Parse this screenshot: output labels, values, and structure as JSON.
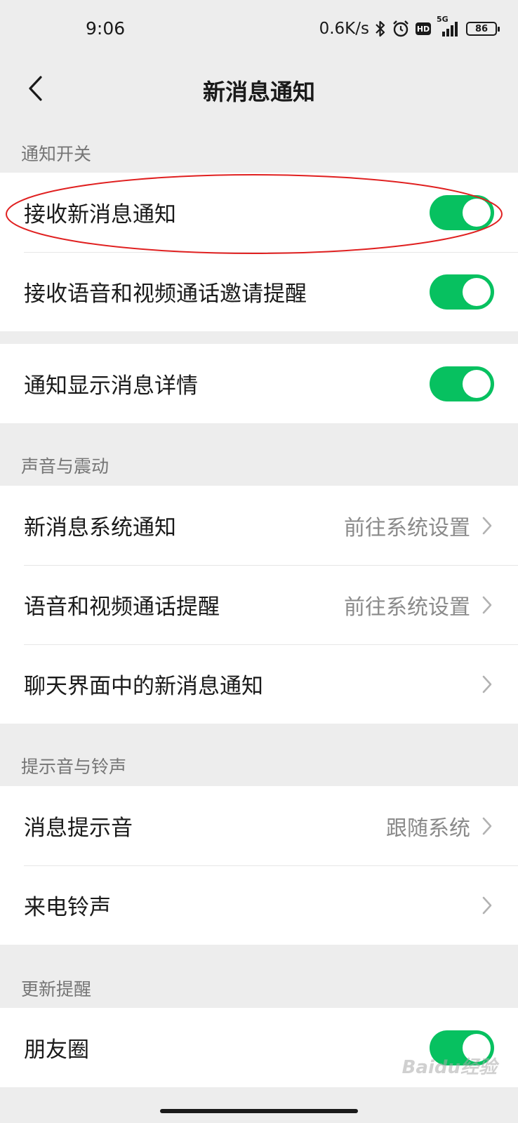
{
  "status_bar": {
    "time": "9:06",
    "network_speed": "0.6K/s",
    "hd_label": "HD",
    "signal_label": "5G",
    "battery": "86",
    "icons": [
      "bluetooth-icon",
      "alarm-icon",
      "hd-icon",
      "signal-icon",
      "battery-icon"
    ]
  },
  "header": {
    "title": "新消息通知",
    "back_icon": "chevron-left-icon"
  },
  "sections": {
    "notify_switch": {
      "title": "通知开关",
      "receive_new": "接收新消息通知",
      "receive_call": "接收语音和视频通话邀请提醒",
      "show_detail": "通知显示消息详情"
    },
    "sound_vibration": {
      "title": "声音与震动",
      "system_notify": "新消息系统通知",
      "system_notify_value": "前往系统设置",
      "call_remind": "语音和视频通话提醒",
      "call_remind_value": "前往系统设置",
      "chat_notify": "聊天界面中的新消息通知"
    },
    "tone_ringtone": {
      "title": "提示音与铃声",
      "message_tone": "消息提示音",
      "message_tone_value": "跟随系统",
      "ringtone": "来电铃声"
    },
    "update_remind": {
      "title": "更新提醒",
      "moments": "朋友圈"
    }
  },
  "toggles": {
    "receive_new": true,
    "receive_call": true,
    "show_detail": true,
    "moments": true
  },
  "colors": {
    "accent": "#07c160",
    "background": "#ededed",
    "highlight": "#e02020"
  },
  "watermark": "Baidu经验"
}
